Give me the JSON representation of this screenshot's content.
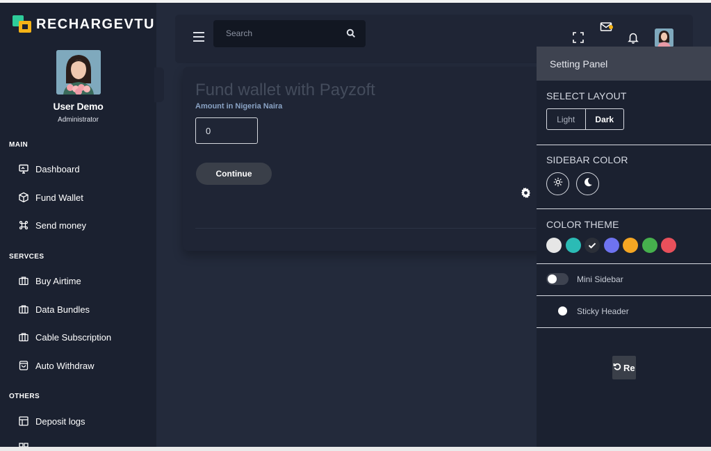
{
  "brand": {
    "name": "RECHARGEVTU"
  },
  "profile": {
    "name": "User Demo",
    "role": "Administrator"
  },
  "sidebar": {
    "sections": [
      {
        "title": "MAIN"
      },
      {
        "title": "SERVCES"
      },
      {
        "title": "OTHERS"
      }
    ],
    "items": [
      {
        "label": "Dashboard",
        "icon": "monitor-icon"
      },
      {
        "label": "Fund Wallet",
        "icon": "box-icon"
      },
      {
        "label": "Send money",
        "icon": "command-icon"
      },
      {
        "label": "Buy Airtime",
        "icon": "briefcase-icon"
      },
      {
        "label": "Data Bundles",
        "icon": "briefcase-icon"
      },
      {
        "label": "Cable Subscription",
        "icon": "briefcase-icon"
      },
      {
        "label": "Auto Withdraw",
        "icon": "shopping-bag-icon"
      },
      {
        "label": "Deposit logs",
        "icon": "layout-icon"
      }
    ]
  },
  "header": {
    "search_placeholder": "Search"
  },
  "card": {
    "title": "Fund wallet with Payzoft",
    "amount_label": "Amount in Nigeria Naira",
    "amount_value": "0",
    "continue_label": "Continue"
  },
  "panel": {
    "title": "Setting Panel",
    "select_layout": "SELECT LAYOUT",
    "layout_options": {
      "light": "Light",
      "dark": "Dark",
      "selected": "Dark"
    },
    "sidebar_color": "SIDEBAR COLOR",
    "color_theme": "COLOR THEME",
    "theme_colors": [
      "#e6e6e6",
      "#2bbbb5",
      "#2b2f38",
      "#6e73f0",
      "#f5a623",
      "#46b04d",
      "#e8505b"
    ],
    "selected_theme_index": 2,
    "mini_sidebar": "Mini Sidebar",
    "sticky_header": "Sticky Header",
    "reset_label": "Re"
  },
  "colors": {
    "sidebar_bg": "#1b2130",
    "body_bg": "#232a3b",
    "accent_green": "#2ecc9a",
    "accent_yellow": "#f5b316"
  }
}
